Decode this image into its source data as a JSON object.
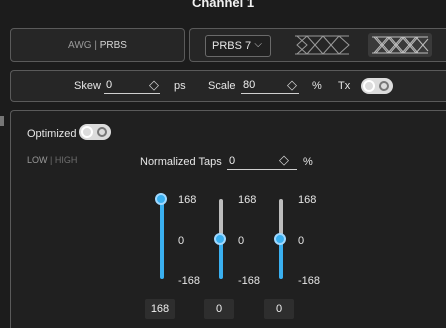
{
  "channel_title": "Channel 1",
  "mode": {
    "awg": "AWG",
    "separator": " | ",
    "prbs": "PRBS"
  },
  "pattern_select": {
    "value": "PRBS 7",
    "chevron": "⌵"
  },
  "eye_icons": [
    "eye-diagram-icon",
    "eye-diagram-filled-icon"
  ],
  "skew": {
    "label": "Skew",
    "value": "0",
    "unit": "ps"
  },
  "scale": {
    "label": "Scale",
    "value": "80",
    "unit": "%"
  },
  "tx": {
    "label": "Tx",
    "on": true
  },
  "optimized": {
    "label": "Optimized",
    "on": true
  },
  "low_high": {
    "low": "LOW",
    "separator": " | ",
    "high": "HIGH"
  },
  "normalized_taps": {
    "label": "Normalized Taps",
    "value": "0",
    "unit": "%"
  },
  "taps": [
    {
      "max": "168",
      "mid": "0",
      "min": "-168",
      "value": "168"
    },
    {
      "max": "168",
      "mid": "0",
      "min": "-168",
      "value": "0"
    },
    {
      "max": "168",
      "mid": "0",
      "min": "-168",
      "value": "0"
    }
  ],
  "colors": {
    "accent": "#3ab0f0",
    "track_inactive": "#bdbdbd",
    "panel_border": "#5a5a5a"
  }
}
